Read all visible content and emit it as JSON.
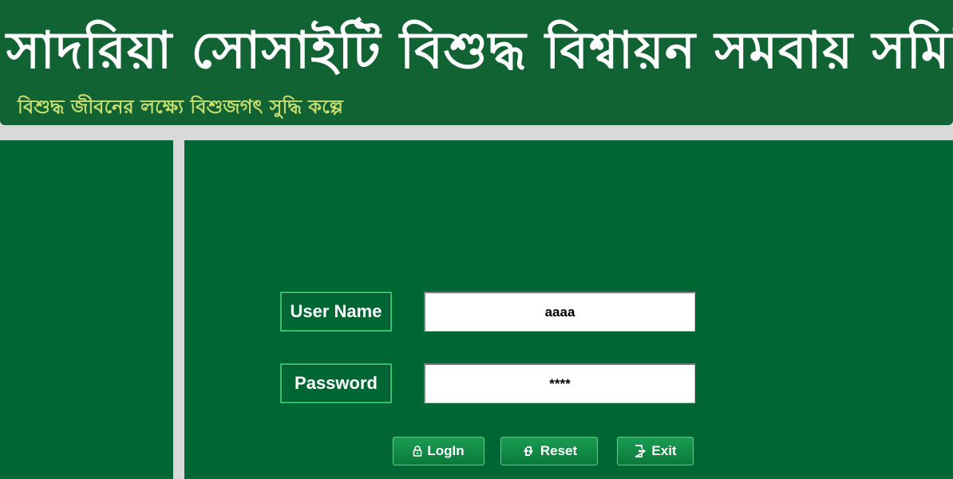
{
  "header": {
    "title": "সাদরিয়া সোসাইটি বিশুদ্ধ বিশ্বায়ন সমবায় সমিতি",
    "subtitle": "বিশুদ্ধ জীবনের লক্ষ্যে বিশুজগৎ সুদ্ধি কল্পে"
  },
  "login": {
    "username_label": "User Name",
    "username_value": "aaaa",
    "password_label": "Password",
    "password_value": "****"
  },
  "buttons": {
    "login": {
      "label": "LogIn",
      "icon": "lock-icon"
    },
    "reset": {
      "label": "Reset",
      "icon": "refresh-icon"
    },
    "exit": {
      "label": "Exit",
      "icon": "exit-icon"
    }
  },
  "colors": {
    "header_bg": "#116333",
    "panel_bg": "#006633",
    "subtitle": "#c7dc6e",
    "page_bg": "#d9d9d9"
  }
}
